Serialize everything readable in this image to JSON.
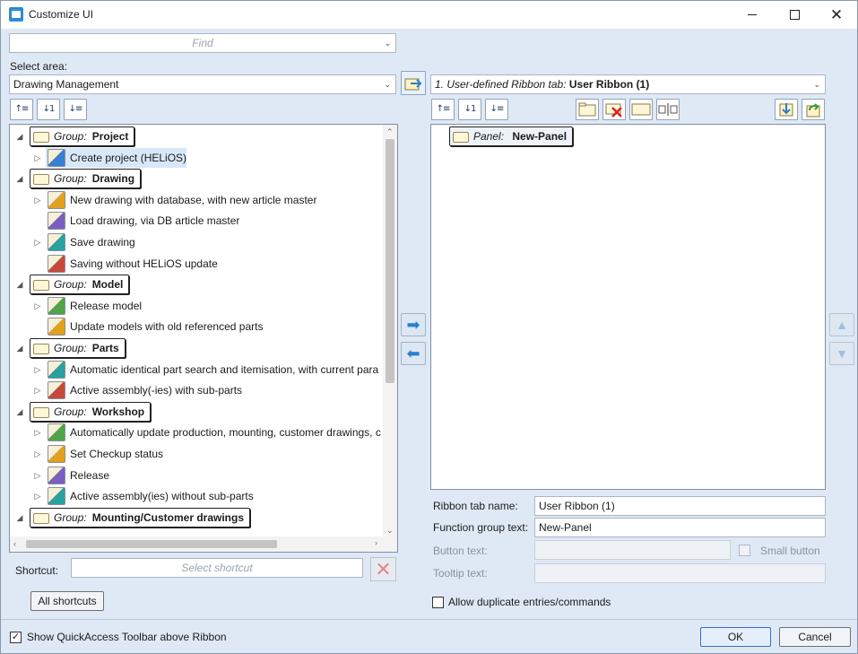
{
  "window": {
    "title": "Customize UI"
  },
  "find": {
    "placeholder": "Find"
  },
  "select_area": {
    "label": "Select area:",
    "value": "Drawing Management"
  },
  "ribbon_selector": {
    "prefix": "1. User-defined Ribbon tab:",
    "name": "User Ribbon (1)"
  },
  "tree": [
    {
      "type": "group",
      "prefix": "Group:",
      "name": "Project"
    },
    {
      "type": "item",
      "label": "Create project (HELiOS)",
      "expandable": true,
      "selected": true
    },
    {
      "type": "group",
      "prefix": "Group:",
      "name": "Drawing"
    },
    {
      "type": "item",
      "label": "New drawing with database, with new article master",
      "expandable": true
    },
    {
      "type": "item",
      "label": "Load drawing, via DB article master",
      "expandable": false
    },
    {
      "type": "item",
      "label": "Save drawing",
      "expandable": true
    },
    {
      "type": "item",
      "label": "Saving without HELiOS update",
      "expandable": false
    },
    {
      "type": "group",
      "prefix": "Group:",
      "name": "Model"
    },
    {
      "type": "item",
      "label": "Release model",
      "expandable": true
    },
    {
      "type": "item",
      "label": "Update models with old referenced parts",
      "expandable": false
    },
    {
      "type": "group",
      "prefix": "Group:",
      "name": "Parts"
    },
    {
      "type": "item",
      "label": "Automatic identical part search and itemisation, with current para",
      "expandable": true
    },
    {
      "type": "item",
      "label": "Active assembly(-ies) with sub-parts",
      "expandable": true
    },
    {
      "type": "group",
      "prefix": "Group:",
      "name": "Workshop"
    },
    {
      "type": "item",
      "label": "Automatically update production, mounting, customer drawings, c",
      "expandable": true
    },
    {
      "type": "item",
      "label": "Set Checkup status",
      "expandable": true
    },
    {
      "type": "item",
      "label": "Release",
      "expandable": true
    },
    {
      "type": "item",
      "label": "Active assembly(ies) without sub-parts",
      "expandable": true
    },
    {
      "type": "group",
      "prefix": "Group:",
      "name": "Mounting/Customer drawings"
    }
  ],
  "panel": {
    "prefix": "Panel:",
    "name": "New-Panel"
  },
  "shortcut": {
    "label": "Shortcut:",
    "placeholder": "Select shortcut",
    "all_button": "All shortcuts"
  },
  "properties": {
    "ribbon_tab_name_label": "Ribbon tab name:",
    "ribbon_tab_name": "User Ribbon (1)",
    "function_group_label": "Function group text:",
    "function_group": "New-Panel",
    "button_text_label": "Button text:",
    "small_button_label": "Small button",
    "tooltip_label": "Tooltip text:"
  },
  "allow_duplicates": {
    "label": "Allow duplicate entries/commands",
    "checked": false
  },
  "show_quickaccess": {
    "label": "Show QuickAccess Toolbar above Ribbon",
    "checked": true
  },
  "buttons": {
    "ok": "OK",
    "cancel": "Cancel"
  },
  "colors": {
    "window_bg": "#dfe9f5",
    "accent": "#2a7fd1",
    "selected_row": "#d8e8f8"
  }
}
